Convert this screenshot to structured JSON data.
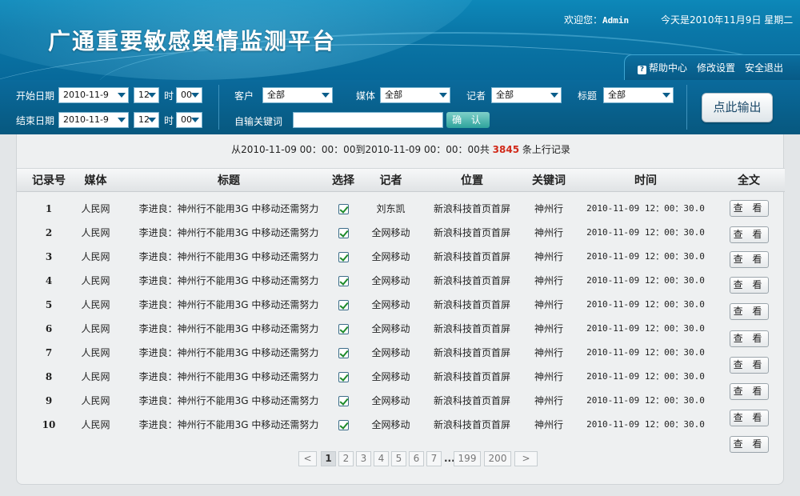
{
  "header": {
    "app_title": "广通重要敏感舆情监测平台",
    "welcome_label": "欢迎您：",
    "username": "Admin",
    "today": "今天是2010年11月9日 星期二",
    "links": {
      "help": "帮助中心",
      "settings": "修改设置",
      "logout": "安全退出"
    }
  },
  "filters": {
    "start_label": "开始日期",
    "end_label": "结束日期",
    "start_date": "2010-11-9",
    "end_date": "2010-11-9",
    "start_hour": "12",
    "end_hour": "12",
    "hour_label": "时",
    "start_min": "00",
    "end_min": "00",
    "client_label": "客户",
    "client_value": "全部",
    "media_label": "媒体",
    "media_value": "全部",
    "reporter_label": "记者",
    "reporter_value": "全部",
    "title_label": "标题",
    "title_value": "全部",
    "keyword_label": "自输关键词",
    "keyword_value": "",
    "confirm_label": "确 认",
    "export_label": "点此输出"
  },
  "summary": {
    "prefix": "从2010-11-09 00：00：00到2010-11-09 00：00：00共",
    "count": "3845",
    "suffix": "条上行记录"
  },
  "table": {
    "columns": [
      "记录号",
      "媒体",
      "标题",
      "选择",
      "记者",
      "位置",
      "关键词",
      "时间",
      "全文"
    ],
    "view_label": "查 看",
    "rows": [
      {
        "no": "1",
        "media": "人民网",
        "title": "李进良：神州行不能用3G 中移动还需努力",
        "reporter": "刘东凯",
        "position": "新浪科技首页首屏",
        "keyword": "神州行",
        "time": "2010-11-09 12：00：30.0"
      },
      {
        "no": "2",
        "media": "人民网",
        "title": "李进良：神州行不能用3G 中移动还需努力",
        "reporter": "全网移动",
        "position": "新浪科技首页首屏",
        "keyword": "神州行",
        "time": "2010-11-09 12：00：30.0"
      },
      {
        "no": "3",
        "media": "人民网",
        "title": "李进良：神州行不能用3G 中移动还需努力",
        "reporter": "全网移动",
        "position": "新浪科技首页首屏",
        "keyword": "神州行",
        "time": "2010-11-09 12：00：30.0"
      },
      {
        "no": "4",
        "media": "人民网",
        "title": "李进良：神州行不能用3G 中移动还需努力",
        "reporter": "全网移动",
        "position": "新浪科技首页首屏",
        "keyword": "神州行",
        "time": "2010-11-09 12：00：30.0"
      },
      {
        "no": "5",
        "media": "人民网",
        "title": "李进良：神州行不能用3G 中移动还需努力",
        "reporter": "全网移动",
        "position": "新浪科技首页首屏",
        "keyword": "神州行",
        "time": "2010-11-09 12：00：30.0"
      },
      {
        "no": "6",
        "media": "人民网",
        "title": "李进良：神州行不能用3G 中移动还需努力",
        "reporter": "全网移动",
        "position": "新浪科技首页首屏",
        "keyword": "神州行",
        "time": "2010-11-09 12：00：30.0"
      },
      {
        "no": "7",
        "media": "人民网",
        "title": "李进良：神州行不能用3G 中移动还需努力",
        "reporter": "全网移动",
        "position": "新浪科技首页首屏",
        "keyword": "神州行",
        "time": "2010-11-09 12：00：30.0"
      },
      {
        "no": "8",
        "media": "人民网",
        "title": "李进良：神州行不能用3G 中移动还需努力",
        "reporter": "全网移动",
        "position": "新浪科技首页首屏",
        "keyword": "神州行",
        "time": "2010-11-09 12：00：30.0"
      },
      {
        "no": "9",
        "media": "人民网",
        "title": "李进良：神州行不能用3G 中移动还需努力",
        "reporter": "全网移动",
        "position": "新浪科技首页首屏",
        "keyword": "神州行",
        "time": "2010-11-09 12：00：30.0"
      },
      {
        "no": "10",
        "media": "人民网",
        "title": "李进良：神州行不能用3G 中移动还需努力",
        "reporter": "全网移动",
        "position": "新浪科技首页首屏",
        "keyword": "神州行",
        "time": "2010-11-09 12：00：30.0"
      }
    ]
  },
  "pagination": {
    "prev": "<",
    "next": ">",
    "pages": [
      "1",
      "2",
      "3",
      "4",
      "5",
      "6",
      "7"
    ],
    "ellipsis": "...",
    "tail_pages": [
      "199",
      "200"
    ],
    "current": "1"
  },
  "colors": {
    "header_blue": "#0a77a8",
    "count_red": "#d12a1a",
    "confirm_green": "#2ea39c"
  }
}
